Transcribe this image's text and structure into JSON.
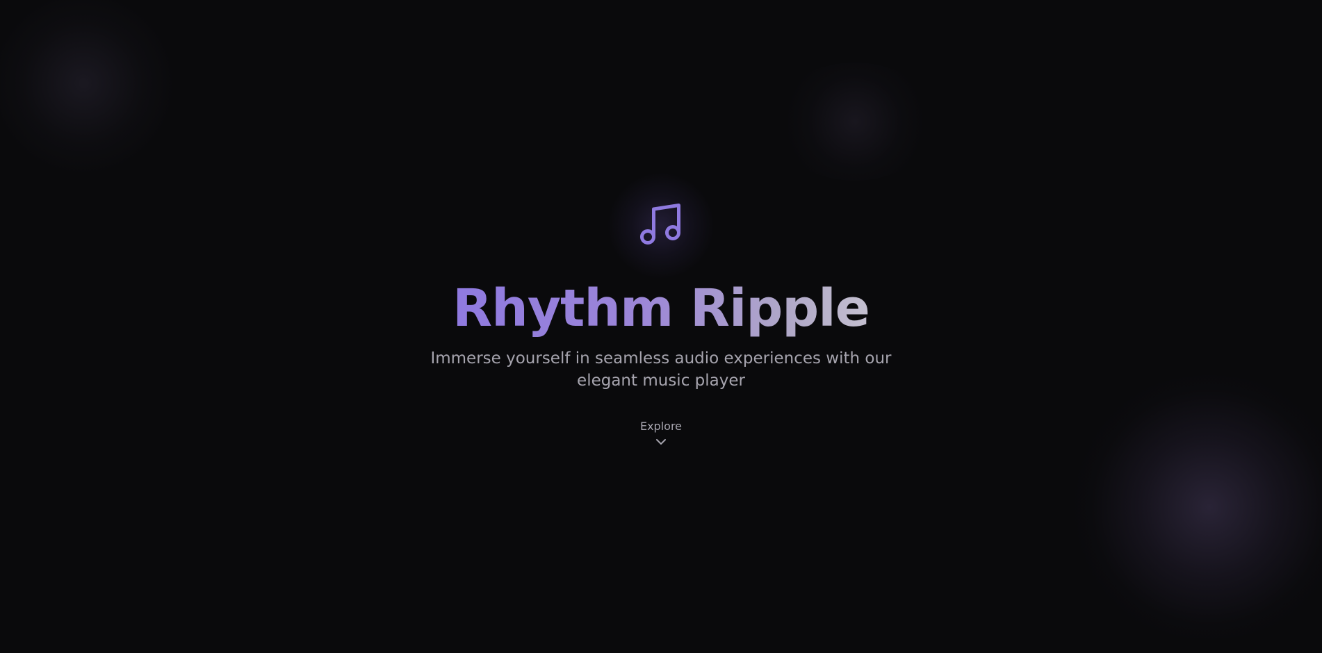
{
  "hero": {
    "title": "Rhythm Ripple",
    "subtitle": "Immerse yourself in seamless audio experiences with our elegant music player",
    "explore_label": "Explore",
    "icon": "music-note-icon",
    "scroll_icon": "chevron-down-icon"
  },
  "colors": {
    "background": "#0a0a0c",
    "accent": "#8f7ae0",
    "title_gradient_end": "#c4c0d0",
    "subtitle": "#a6a4ae"
  }
}
